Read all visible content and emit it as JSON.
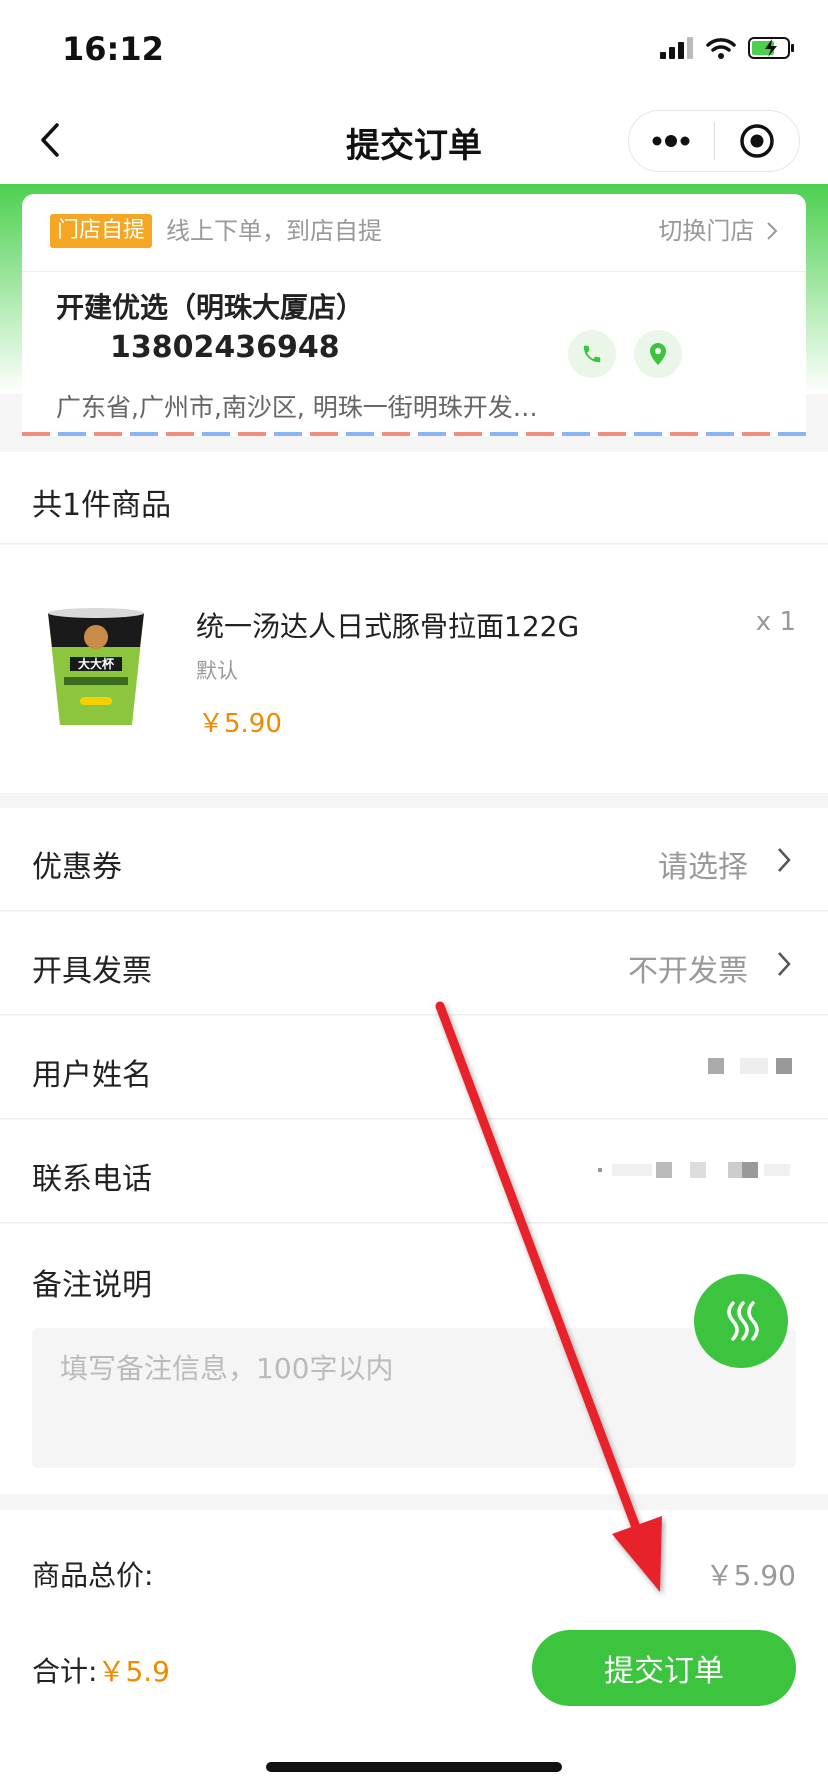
{
  "status_bar": {
    "time": "16:12"
  },
  "nav": {
    "title": "提交订单"
  },
  "store": {
    "badge": "门店自提",
    "description": "线上下单，到店自提",
    "switch_label": "切换门店",
    "name": "开建优选（明珠大厦店）",
    "phone": "13802436948",
    "address": "广东省,广州市,南沙区, 明珠一街明珠开发…"
  },
  "goods": {
    "count_label": "共1件商品",
    "item": {
      "name": "统一汤达人日式豚骨拉面122G",
      "spec": "默认",
      "price": "￥5.90",
      "quantity": "x 1",
      "image_text": "大大杯"
    }
  },
  "form": {
    "coupon": {
      "label": "优惠券",
      "value": "请选择"
    },
    "invoice": {
      "label": "开具发票",
      "value": "不开发票"
    },
    "username": {
      "label": "用户姓名"
    },
    "phone": {
      "label": "联系电话"
    },
    "remark": {
      "label": "备注说明",
      "placeholder": "填写备注信息，100字以内"
    }
  },
  "footer": {
    "total_label": "商品总价:",
    "total_value": "￥5.90",
    "sum_label": "合计:",
    "sum_value": "￥5.9",
    "submit_label": "提交订单"
  },
  "colors": {
    "brand_green": "#3cc43f",
    "price_orange": "#f08a00",
    "badge_orange": "#f5a623",
    "arrow_red": "#e8232b"
  },
  "icons": [
    "back-chevron-icon",
    "more-dots-icon",
    "record-circle-icon",
    "phone-icon",
    "location-pin-icon",
    "chevron-right-icon",
    "wave-icon",
    "signal-icon",
    "wifi-icon",
    "battery-charging-icon"
  ]
}
